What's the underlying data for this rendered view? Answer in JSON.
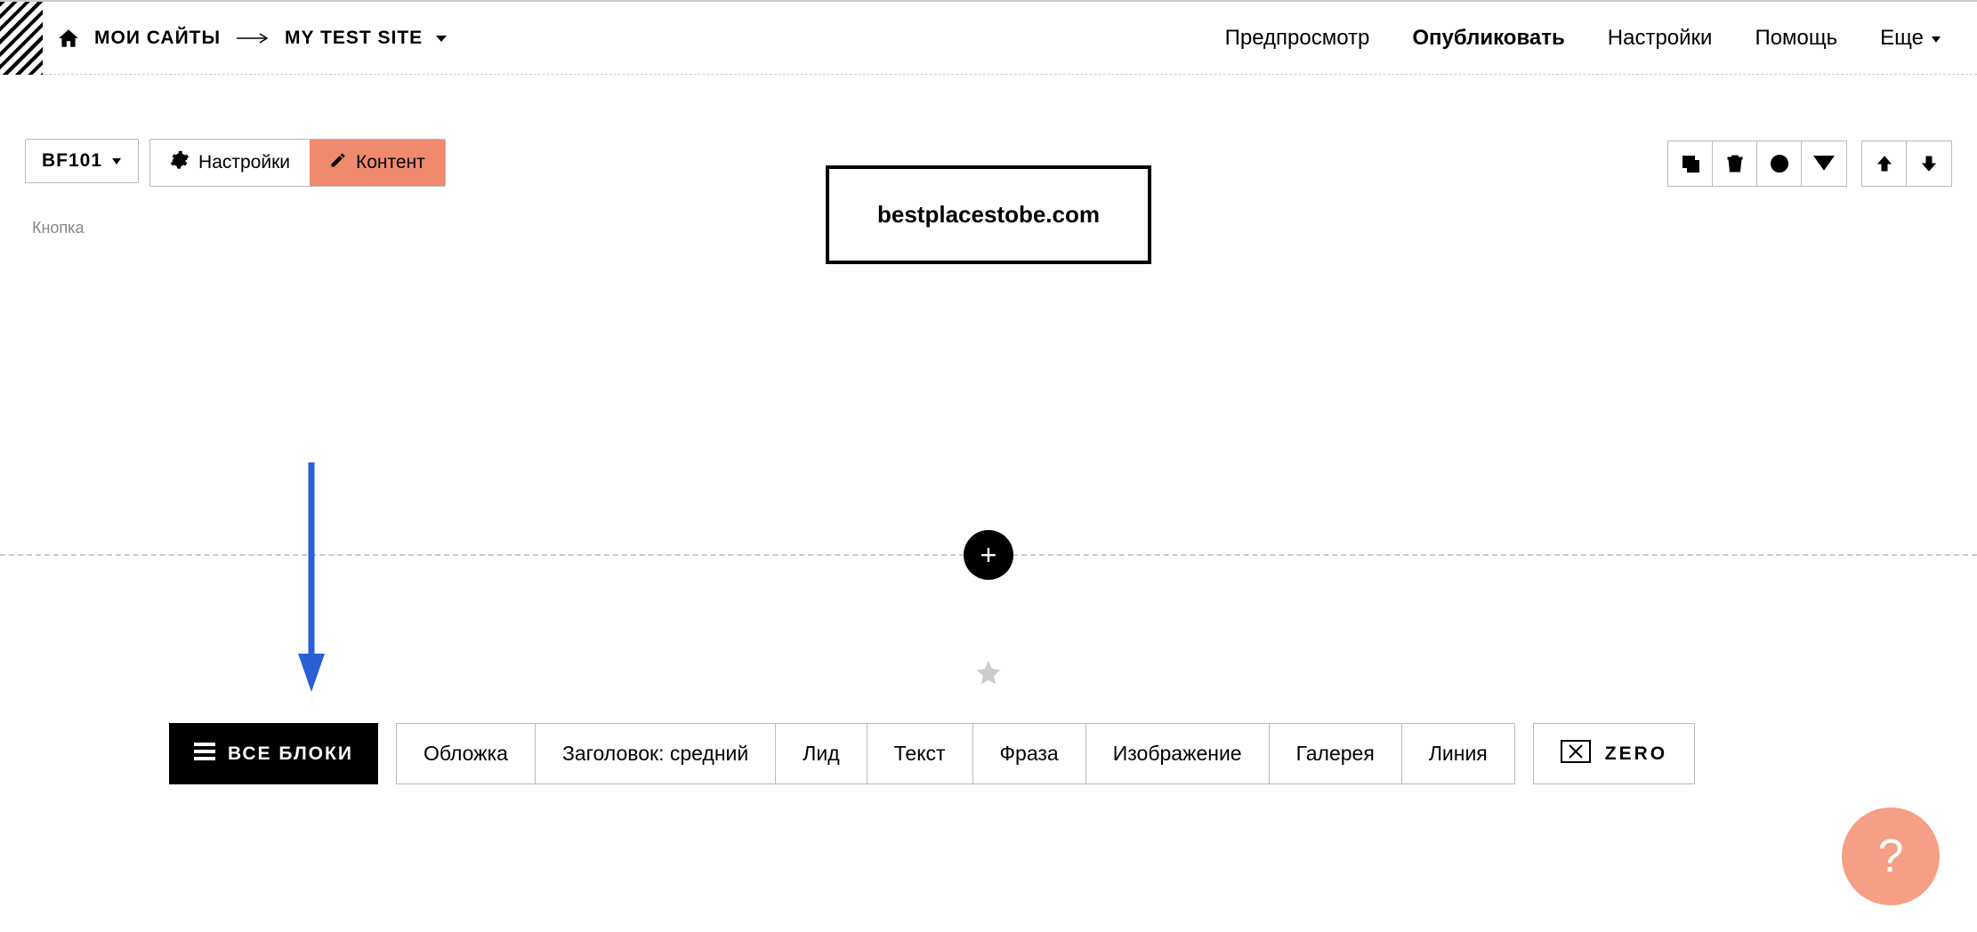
{
  "topbar": {
    "my_sites": "МОИ САЙТЫ",
    "site_name": "MY TEST SITE",
    "links": {
      "preview": "Предпросмотр",
      "publish": "Опубликовать",
      "settings": "Настройки",
      "help": "Помощь",
      "more": "Еще"
    }
  },
  "block_toolbar": {
    "block_id": "BF101",
    "settings_label": "Настройки",
    "content_label": "Контент"
  },
  "block_label": "Кнопка",
  "canvas": {
    "button_text": "bestplacestobe.com"
  },
  "bottom_toolbar": {
    "all_blocks": "ВСЕ БЛОКИ",
    "categories": [
      "Обложка",
      "Заголовок: средний",
      "Лид",
      "Текст",
      "Фраза",
      "Изображение",
      "Галерея",
      "Линия"
    ],
    "zero": "ZERO"
  },
  "help_bubble": "?"
}
